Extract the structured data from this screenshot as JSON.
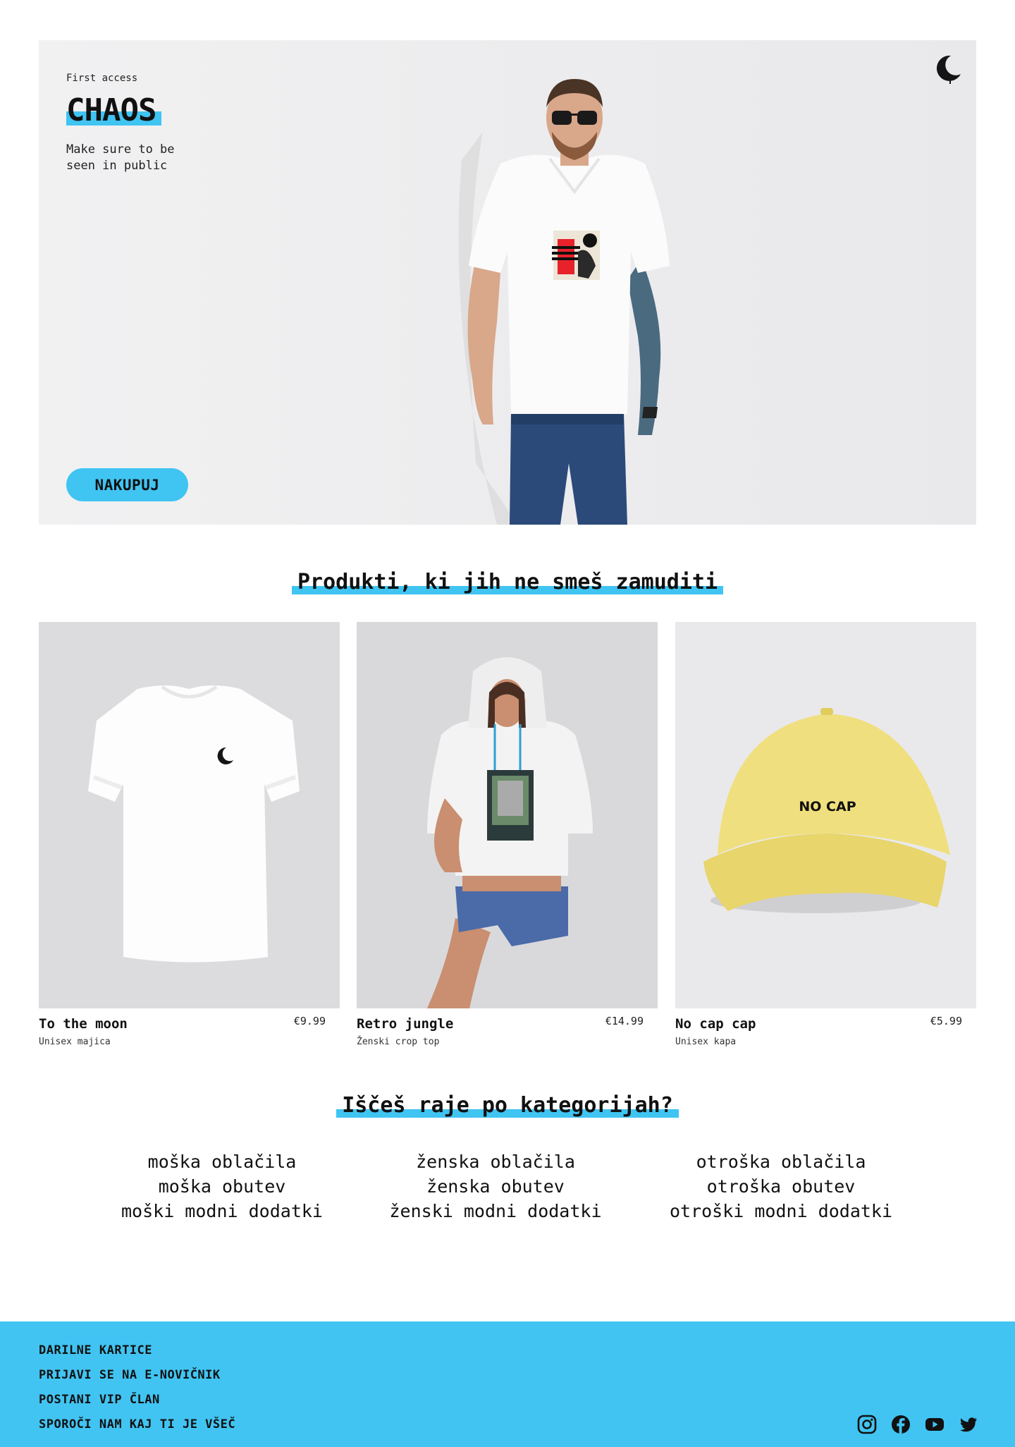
{
  "hero": {
    "eyebrow": "First access",
    "title": "CHAOS",
    "tagline": "Make sure to be seen in public",
    "cta_label": "NAKUPUJ",
    "icons": [
      "moon-logo-icon"
    ],
    "model_tshirt_color": "#ffffff",
    "model_jeans_color": "#2b4a7a"
  },
  "products_section": {
    "heading": "Produkti, ki jih ne smeš zamuditi",
    "items": [
      {
        "name": "To the moon",
        "type": "Unisex majica",
        "price": "€9.99",
        "bg": "#dcdcde"
      },
      {
        "name": "Retro jungle",
        "type": "Ženski crop top",
        "price": "€14.99",
        "bg": "#d9d9dc"
      },
      {
        "name": "No cap cap",
        "type": "Unisex kapa",
        "price": "€5.99",
        "bg": "#e9e9ec",
        "print_text": "NO CAP"
      }
    ]
  },
  "categories_section": {
    "heading": "Iščeš raje po kategorijah?",
    "columns": [
      [
        "moška oblačila",
        "moška obutev",
        "moški modni dodatki"
      ],
      [
        "ženska oblačila",
        "ženska obutev",
        "ženski modni dodatki"
      ],
      [
        "otroška oblačila",
        "otroška obutev",
        "otroški modni dodatki"
      ]
    ]
  },
  "footer": {
    "links": [
      "DARILNE KARTICE",
      "PRIJAVI SE NA E-NOVIČNIK",
      "POSTANI VIP ČLAN",
      "SPOROČI NAM KAJ TI JE VŠEČ"
    ],
    "social_icons": [
      "instagram-icon",
      "facebook-icon",
      "youtube-icon",
      "twitter-icon"
    ]
  },
  "colors": {
    "accent": "#40c4f2",
    "text": "#111111",
    "background": "#ffffff"
  }
}
